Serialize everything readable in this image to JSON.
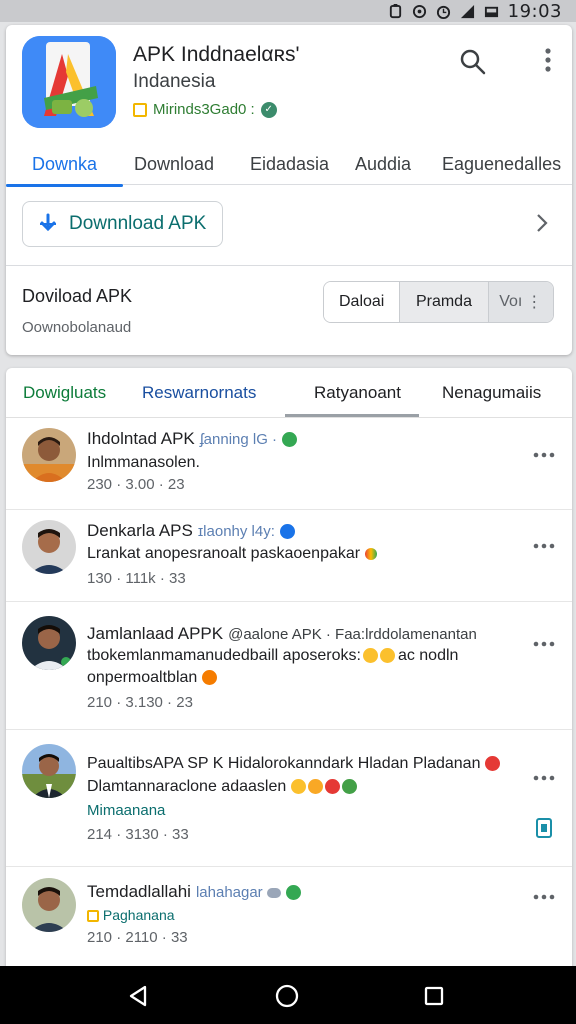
{
  "status_bar": {
    "time": "19:03"
  },
  "app": {
    "title": "APK Inddnaelαʀs'",
    "subtitle": "Indanesia",
    "developer": "Mirinds3Gad0 :"
  },
  "tabs": [
    {
      "label": "Downka",
      "active": true
    },
    {
      "label": "Download"
    },
    {
      "label": "Eidadasia"
    },
    {
      "label": "Auddia"
    },
    {
      "label": "Eaguenedalles"
    }
  ],
  "download_button": {
    "label": "Downnload APK"
  },
  "section": {
    "title": "Doviload APK",
    "subtitle": "Oownobolanaud",
    "segments": [
      "Daloai",
      "Pramda",
      "Voı"
    ]
  },
  "feed_tabs": [
    {
      "label": "Dowigluats",
      "color": "#0d7c3a"
    },
    {
      "label": "Reswarnornats",
      "color": "#1a4fa0"
    },
    {
      "label": "Ratyanoant",
      "active": true
    },
    {
      "label": "Nenagumaiis"
    }
  ],
  "feed": [
    {
      "name": "Ihdolntad APK",
      "handle": "ʄanning lG ·",
      "lines": [
        "Inlmmanasolen."
      ],
      "meta": "230 · 3.00 · 23"
    },
    {
      "name": "Denkarla APS",
      "handle": "ɪlaonhy l4y:",
      "lines": [
        "Lrankat anopesranoalt paskaoenpakar"
      ],
      "meta": "130 · 111k · 33"
    },
    {
      "name": "Jamlanlaad APPK",
      "handle": "@aalone APK · Faa:lrddolamenantan",
      "lines": [
        "tbokemlanmamanudedbaill aposeroks:",
        "onpermoaltblan"
      ],
      "line_suffix": "ac nodln",
      "meta": "210 · 3.130 · 23"
    },
    {
      "name": "PaualtibsAPA SP K",
      "handle": "Hidalorokanndark Hladan Pladanan",
      "lines": [
        "Dlamtannaraclone adaaslen"
      ],
      "sub": "Mimaanana",
      "meta": "214 · 3130 · 33"
    },
    {
      "name": "Temdadlallahi",
      "handle": "lahahagar",
      "sub": "Paghanana",
      "meta": "210 · 2110 · 33"
    }
  ],
  "colors": {
    "accent": "#1a73e8",
    "green": "#0d7c3a",
    "navbar": "#000000"
  },
  "icons": [
    "search-icon",
    "more-vert-icon",
    "download-arrow-icon",
    "chevron-right-icon",
    "back-icon",
    "home-icon",
    "recents-icon"
  ]
}
